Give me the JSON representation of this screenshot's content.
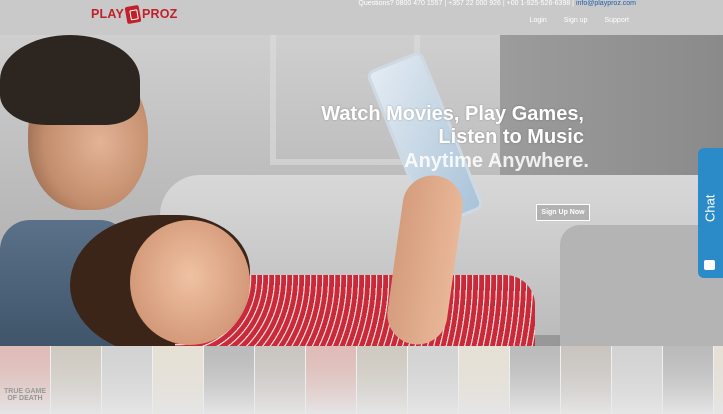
{
  "brand": {
    "name_left": "PLAY",
    "name_right": "PROZ",
    "color": "#c0202a"
  },
  "header": {
    "contact_text": "Questions? 0800 470 1557 | +357 22 000 926 | +00 1-925-526-6398 |",
    "email": "info@playproz.com",
    "nav": {
      "login": "Login",
      "signup": "Sign up",
      "support": "Support"
    }
  },
  "hero": {
    "headline_line1": "Watch Movies, Play Games,",
    "headline_line2": "Listen to Music",
    "subline": "Anytime Anywhere.",
    "cta": "Sign Up Now"
  },
  "chat": {
    "label": "Chat",
    "color": "#2a8bc8"
  },
  "posters": [
    {
      "label": "TRUE GAME OF DEATH",
      "color": "#b23b2e"
    },
    {
      "label": "",
      "color": "#7d6a4c"
    },
    {
      "label": "",
      "color": "#8a8a8a"
    },
    {
      "label": "",
      "color": "#c9b88f"
    },
    {
      "label": "",
      "color": "#3a3a3a"
    },
    {
      "label": "",
      "color": "#6a5a4a"
    },
    {
      "label": "",
      "color": "#b23b2e"
    },
    {
      "label": "",
      "color": "#7d6a4c"
    },
    {
      "label": "",
      "color": "#8a8a8a"
    },
    {
      "label": "",
      "color": "#c9b88f"
    },
    {
      "label": "",
      "color": "#3a3a3a"
    },
    {
      "label": "",
      "color": "#6a5a4a"
    },
    {
      "label": "",
      "color": "#8a8a8a"
    },
    {
      "label": "",
      "color": "#3a3a3a"
    },
    {
      "label": "",
      "color": "#c9b88f"
    }
  ]
}
